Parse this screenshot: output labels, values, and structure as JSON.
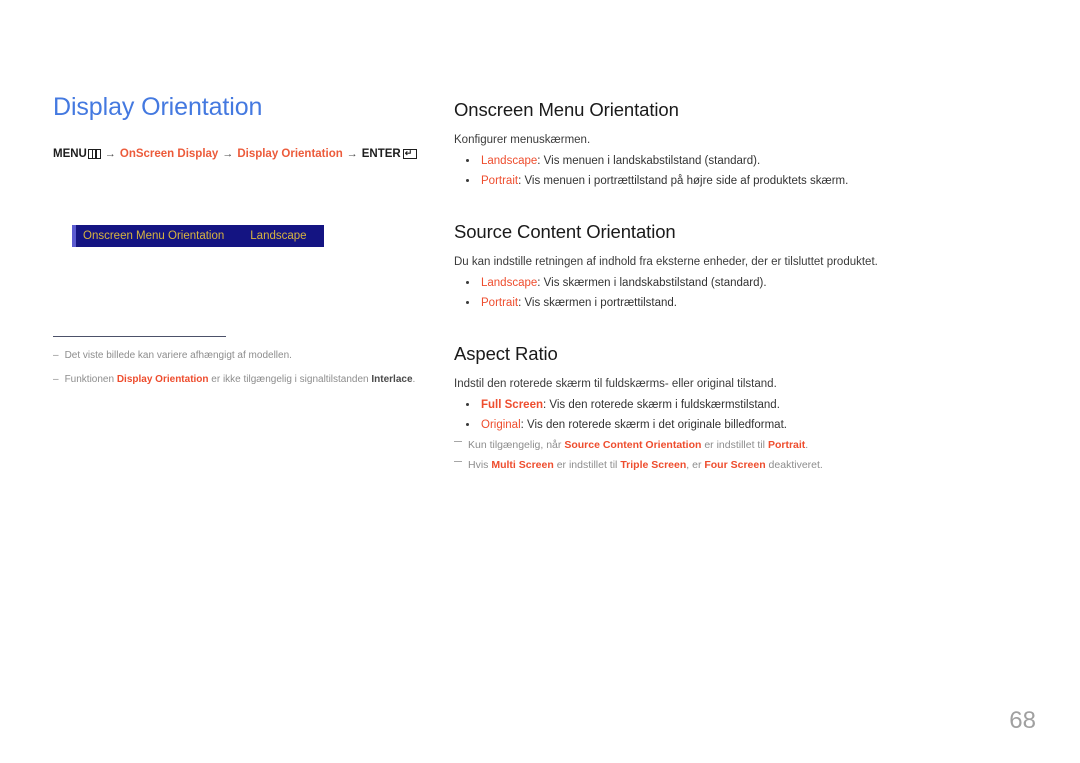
{
  "document": {
    "page_number": "68",
    "title_color": "#4479e0",
    "accent_color": "#ee4d2e",
    "osd_box_bg": "#141482",
    "osd_box_text": "#d8b53f"
  },
  "left": {
    "title": "Display Orientation",
    "menu_path": {
      "root_label": "MENU",
      "menu_icon": "menu-bars-icon",
      "arrow": "→",
      "step1": "OnScreen Display",
      "step2": "Display Orientation",
      "enter_label": "ENTER",
      "enter_icon": "enter-return-icon"
    },
    "osd_preview": {
      "label": "Onscreen Menu Orientation",
      "value": "Landscape"
    },
    "notes": [
      {
        "dash": "–",
        "parts": [
          {
            "text": "Det viste billede kan variere afhængigt af modellen.",
            "style": "plain"
          }
        ]
      },
      {
        "dash": "–",
        "parts": [
          {
            "text": "Funktionen ",
            "style": "plain"
          },
          {
            "text": "Display Orientation",
            "style": "kw-red"
          },
          {
            "text": " er ikke tilgængelig i signaltilstanden ",
            "style": "plain"
          },
          {
            "text": "Interlace",
            "style": "kw-dark"
          },
          {
            "text": ".",
            "style": "plain"
          }
        ]
      }
    ]
  },
  "right": {
    "sections": [
      {
        "heading": "Onscreen Menu Orientation",
        "intro": "Konfigurer menuskærmen.",
        "bullets": [
          {
            "parts": [
              {
                "text": "Landscape",
                "style": "kw"
              },
              {
                "text": ": Vis menuen i landskabstilstand (standard).",
                "style": "plain"
              }
            ]
          },
          {
            "parts": [
              {
                "text": "Portrait",
                "style": "kw"
              },
              {
                "text": ": Vis menuen i portrættilstand på højre side af produktets skærm.",
                "style": "plain"
              }
            ]
          }
        ],
        "subnotes": []
      },
      {
        "heading": "Source Content Orientation",
        "intro": "Du kan indstille retningen af indhold fra eksterne enheder, der er tilsluttet produktet.",
        "bullets": [
          {
            "parts": [
              {
                "text": "Landscape",
                "style": "kw"
              },
              {
                "text": ": Vis skærmen i landskabstilstand (standard).",
                "style": "plain"
              }
            ]
          },
          {
            "parts": [
              {
                "text": "Portrait",
                "style": "kw"
              },
              {
                "text": ": Vis skærmen i portrættilstand.",
                "style": "plain"
              }
            ]
          }
        ],
        "subnotes": []
      },
      {
        "heading": "Aspect Ratio",
        "intro": "Indstil den roterede skærm til fuldskærms- eller original tilstand.",
        "bullets": [
          {
            "parts": [
              {
                "text": "Full Screen",
                "style": "kw-b"
              },
              {
                "text": ": Vis den roterede skærm i fuldskærmstilstand.",
                "style": "plain"
              }
            ]
          },
          {
            "parts": [
              {
                "text": "Original",
                "style": "kw"
              },
              {
                "text": ": Vis den roterede skærm i det originale billedformat.",
                "style": "plain"
              }
            ]
          }
        ],
        "subnotes": [
          {
            "parts": [
              {
                "text": "Kun tilgængelig, når ",
                "style": "plain"
              },
              {
                "text": "Source Content Orientation",
                "style": "kw-red"
              },
              {
                "text": " er indstillet til ",
                "style": "plain"
              },
              {
                "text": "Portrait",
                "style": "kw-red"
              },
              {
                "text": ".",
                "style": "plain"
              }
            ]
          },
          {
            "parts": [
              {
                "text": "Hvis ",
                "style": "plain"
              },
              {
                "text": "Multi Screen",
                "style": "kw-red"
              },
              {
                "text": " er indstillet til ",
                "style": "plain"
              },
              {
                "text": "Triple Screen",
                "style": "kw-red"
              },
              {
                "text": ", er ",
                "style": "plain"
              },
              {
                "text": "Four Screen",
                "style": "kw-red"
              },
              {
                "text": " deaktiveret.",
                "style": "plain"
              }
            ]
          }
        ]
      }
    ]
  }
}
